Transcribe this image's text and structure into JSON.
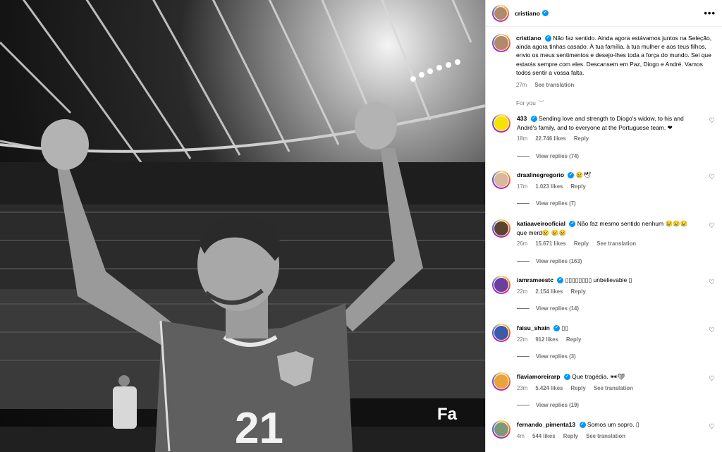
{
  "post": {
    "author": "cristiano",
    "more_label": "•••",
    "caption": {
      "username": "cristiano",
      "text": "Não faz sentido. Ainda agora estávamos juntos na Seleção, ainda agora tinhas casado. À tua família, à tua mulher e aos teus filhos, envio os meus sentimentos e desejo-lhes toda a força do mundo. Sei que estarás sempre com eles. Descansem em Paz, Diogo e André. Vamos todos sentir a vossa falta.",
      "time": "27m",
      "translate": "See translation"
    },
    "photo": {
      "jersey_number": "21",
      "ad_board": "Fa"
    }
  },
  "for_you": "For you",
  "comments": [
    {
      "username": "433",
      "text": "Sending love and strength to Diogo's widow, to his and André's family, and to everyone at the Portuguese team.",
      "emoji": "❤",
      "time": "18m",
      "likes": "22.746 likes",
      "reply": "Reply",
      "translate": "",
      "replies": "View replies (74)",
      "avatar_color": "#f4e400"
    },
    {
      "username": "draalinegregorio",
      "text": "",
      "emoji": "😢🕊",
      "time": "17m",
      "likes": "1.023 likes",
      "reply": "Reply",
      "translate": "",
      "replies": "View replies (7)",
      "avatar_color": "#d9b7a0"
    },
    {
      "username": "katiaaveirooficial",
      "text": "Não faz mesmo sentido nenhum 😢😢😢 que merd😢 😢😢",
      "emoji": "",
      "time": "26m",
      "likes": "15.671 likes",
      "reply": "Reply",
      "translate": "See translation",
      "replies": "View replies (163)",
      "avatar_color": "#5a4331"
    },
    {
      "username": "iamrameestc",
      "text": "▯▯▯▯▯▯▯▯ unbelievable ▯",
      "emoji": "",
      "time": "22m",
      "likes": "2.154 likes",
      "reply": "Reply",
      "translate": "",
      "replies": "View replies (14)",
      "avatar_color": "#6b3fa0"
    },
    {
      "username": "faisu_shain",
      "text": "▯▯",
      "emoji": "",
      "time": "22m",
      "likes": "912 likes",
      "reply": "Reply",
      "translate": "",
      "replies": "View replies (3)",
      "avatar_color": "#3c5aa6"
    },
    {
      "username": "flaviamoreirarp",
      "text": "Que tragédia.",
      "emoji": "🕶❤",
      "time": "23m",
      "likes": "5.424 likes",
      "reply": "Reply",
      "translate": "See translation",
      "replies": "View replies (19)",
      "avatar_color": "#e8a33a"
    },
    {
      "username": "fernando_pimenta13",
      "text": "Somos um sopro. ▯",
      "emoji": "",
      "time": "4m",
      "likes": "544 likes",
      "reply": "Reply",
      "translate": "See translation",
      "replies": "",
      "avatar_color": "#7d9a78"
    }
  ]
}
